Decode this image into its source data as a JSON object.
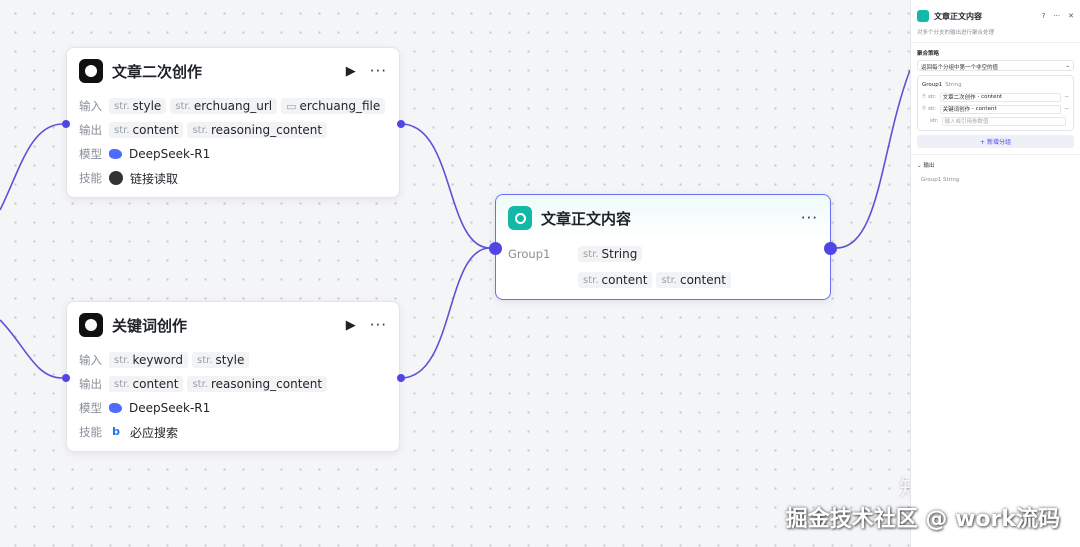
{
  "node1": {
    "title": "文章二次创作",
    "input_label": "输入",
    "output_label": "输出",
    "model_label": "模型",
    "skill_label": "技能",
    "inputs": [
      {
        "type": "str.",
        "name": "style"
      },
      {
        "type": "str.",
        "name": "erchuang_url"
      },
      {
        "type": "file",
        "name": "erchuang_file"
      }
    ],
    "outputs": [
      {
        "type": "str.",
        "name": "content"
      },
      {
        "type": "str.",
        "name": "reasoning_content"
      }
    ],
    "model": "DeepSeek-R1",
    "skill": "链接读取"
  },
  "node2": {
    "title": "关键词创作",
    "input_label": "输入",
    "output_label": "输出",
    "model_label": "模型",
    "skill_label": "技能",
    "inputs": [
      {
        "type": "str.",
        "name": "keyword"
      },
      {
        "type": "str.",
        "name": "style"
      }
    ],
    "outputs": [
      {
        "type": "str.",
        "name": "content"
      },
      {
        "type": "str.",
        "name": "reasoning_content"
      }
    ],
    "model": "DeepSeek-R1",
    "skill": "必应搜索"
  },
  "aggregator": {
    "title": "文章正文内容",
    "group": "Group1",
    "group_type": {
      "type": "str.",
      "name": "String"
    },
    "vars": [
      {
        "type": "str.",
        "name": "content"
      },
      {
        "type": "str.",
        "name": "content"
      }
    ]
  },
  "panel": {
    "title": "文章正文内容",
    "description": "对多个分支的输出进行聚合处理",
    "strategy_label": "聚合策略",
    "strategy_value": "返回每个分组中第一个非空的值",
    "group_name": "Group1",
    "group_type": "String",
    "rows": [
      {
        "type": "str.",
        "source": "文章二次创作",
        "var": "content"
      },
      {
        "type": "str.",
        "source": "关键词创作",
        "var": "content"
      }
    ],
    "empty_placeholder": "输入或引用参数值",
    "add_group": "+ 新增分组",
    "output_label": "输出",
    "output_group": "Group1",
    "output_type": "String"
  },
  "watermark": {
    "line1": "知乎 @柿哥电商",
    "line2": "掘金技术社区 @ work流码"
  },
  "colors": {
    "edge": "#4f46e5",
    "accent_teal": "#14b8a6"
  }
}
